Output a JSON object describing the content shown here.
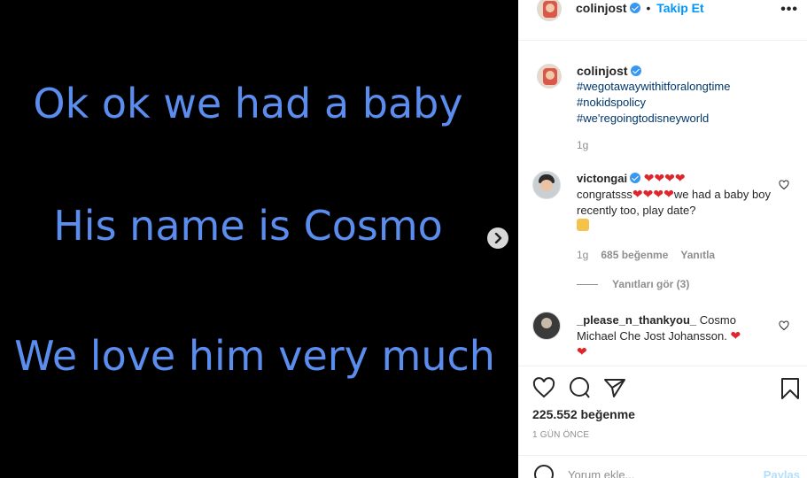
{
  "media": {
    "lines": [
      "Ok ok we had a baby",
      "His name is Cosmo",
      "We love him very much"
    ],
    "text_color": "#5b8dee",
    "background": "#000000"
  },
  "header": {
    "username": "colinjost",
    "separator": "•",
    "follow_label": "Takip Et",
    "more_label": "•••"
  },
  "caption": {
    "username": "colinjost",
    "hashtags": [
      "#wegotawaywithitforalongtime",
      "#nokidspolicy",
      "#we'regoingtodisneyworld"
    ],
    "time": "1g"
  },
  "comments": [
    {
      "username": "victongai",
      "text_after_hearts": "we had a baby boy recently too, play date?",
      "prefix": "congratsss",
      "time": "1g",
      "likes": "685 beğenme",
      "reply_label": "Yanıtla",
      "view_replies": "Yanıtları gör (3)"
    },
    {
      "username": "_please_n_thankyou_",
      "text": "Cosmo Michael Che Jost Johansson."
    }
  ],
  "actions": {
    "likes": "225.552 beğenme",
    "date": "1 GÜN ÖNCE"
  },
  "comment_box": {
    "placeholder": "Yorum ekle...",
    "post_label": "Paylaş"
  },
  "colors": {
    "accent": "#0095f6",
    "hashtag": "#00376b",
    "heart": "#e0242b",
    "verified": "#3897f0"
  }
}
